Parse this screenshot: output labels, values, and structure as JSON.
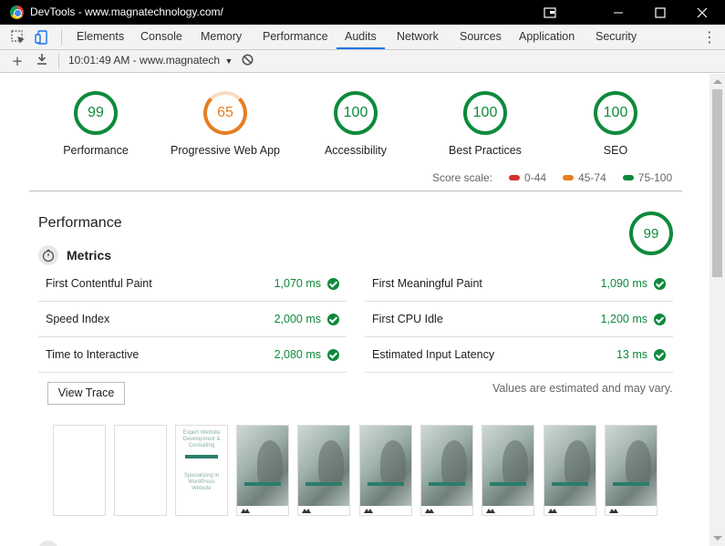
{
  "window": {
    "title": "DevTools - www.magnatechnology.com/"
  },
  "devtools": {
    "tabs": [
      "Elements",
      "Console",
      "Memory",
      "Performance",
      "Audits",
      "Network",
      "Sources",
      "Application",
      "Security"
    ],
    "active_tab": "Audits",
    "report_select": "10:01:49 AM - www.magnatech"
  },
  "gauges": [
    {
      "score": "99",
      "label": "Performance",
      "rating": "pass"
    },
    {
      "score": "65",
      "label": "Progressive Web App",
      "rating": "average"
    },
    {
      "score": "100",
      "label": "Accessibility",
      "rating": "pass"
    },
    {
      "score": "100",
      "label": "Best Practices",
      "rating": "pass"
    },
    {
      "score": "100",
      "label": "SEO",
      "rating": "pass"
    }
  ],
  "score_scale": {
    "label": "Score scale:",
    "ranges": [
      {
        "text": "0-44",
        "color": "#d32f2f"
      },
      {
        "text": "45-74",
        "color": "#e67e22"
      },
      {
        "text": "75-100",
        "color": "#0d8a3b"
      }
    ]
  },
  "performance": {
    "title": "Performance",
    "score": "99",
    "metrics_title": "Metrics",
    "metrics": [
      {
        "label": "First Contentful Paint",
        "value": "1,070 ms"
      },
      {
        "label": "First Meaningful Paint",
        "value": "1,090 ms"
      },
      {
        "label": "Speed Index",
        "value": "2,000 ms"
      },
      {
        "label": "First CPU Idle",
        "value": "1,200 ms"
      },
      {
        "label": "Time to Interactive",
        "value": "2,080 ms"
      },
      {
        "label": "Estimated Input Latency",
        "value": "13 ms"
      }
    ],
    "view_trace_label": "View Trace",
    "estimated_note": "Values are estimated and may vary."
  },
  "filmstrip": {
    "frame3": {
      "title": "Expert Website Development & Consulting",
      "subtitle": "Specializing in WordPress Website"
    }
  },
  "colors": {
    "pass": "#0d8a3b",
    "average": "#e67e22",
    "fail": "#d32f2f",
    "active_tab_underline": "#1a73e8"
  }
}
